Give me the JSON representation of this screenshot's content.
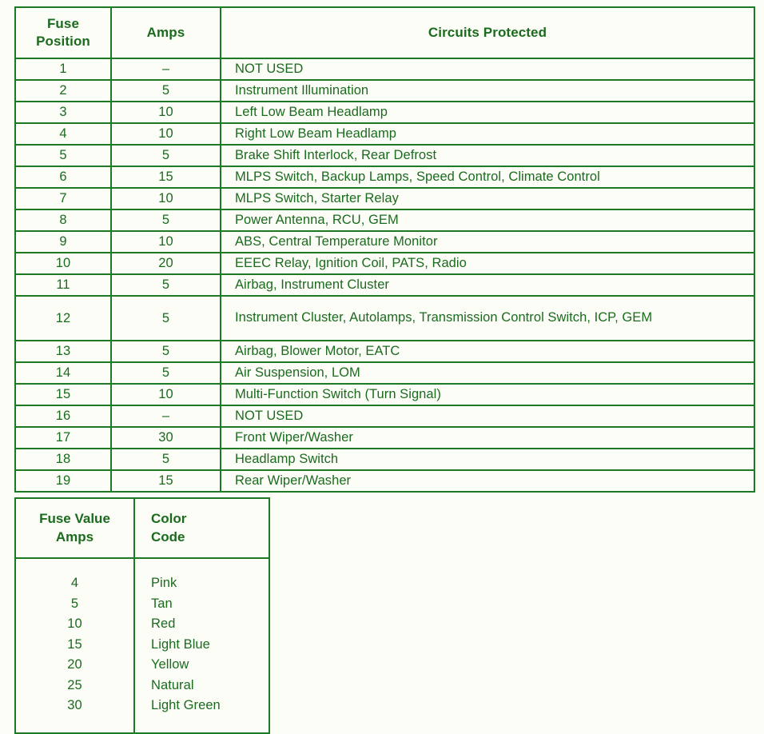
{
  "fuse_table": {
    "headers": {
      "position": "Fuse\nPosition",
      "position_line1": "Fuse",
      "position_line2": "Position",
      "amps": "Amps",
      "circuits": "Circuits Protected"
    },
    "rows": [
      {
        "position": "1",
        "amps": "–",
        "circuits": "NOT USED"
      },
      {
        "position": "2",
        "amps": "5",
        "circuits": "Instrument Illumination"
      },
      {
        "position": "3",
        "amps": "10",
        "circuits": "Left Low Beam Headlamp"
      },
      {
        "position": "4",
        "amps": "10",
        "circuits": "Right Low Beam Headlamp"
      },
      {
        "position": "5",
        "amps": "5",
        "circuits": "Brake Shift Interlock, Rear Defrost"
      },
      {
        "position": "6",
        "amps": "15",
        "circuits": "MLPS Switch, Backup Lamps, Speed Control, Climate Control"
      },
      {
        "position": "7",
        "amps": "10",
        "circuits": "MLPS Switch, Starter Relay"
      },
      {
        "position": "8",
        "amps": "5",
        "circuits": "Power Antenna, RCU, GEM"
      },
      {
        "position": "9",
        "amps": "10",
        "circuits": "ABS, Central Temperature Monitor"
      },
      {
        "position": "10",
        "amps": "20",
        "circuits": "EEEC Relay, Ignition Coil, PATS, Radio"
      },
      {
        "position": "11",
        "amps": "5",
        "circuits": "Airbag, Instrument Cluster"
      },
      {
        "position": "12",
        "amps": "5",
        "circuits": "Instrument Cluster, Autolamps, Transmission Control Switch, ICP, GEM",
        "tall": true
      },
      {
        "position": "13",
        "amps": "5",
        "circuits": "Airbag, Blower Motor, EATC"
      },
      {
        "position": "14",
        "amps": "5",
        "circuits": "Air Suspension, LOM"
      },
      {
        "position": "15",
        "amps": "10",
        "circuits": "Multi-Function Switch (Turn Signal)"
      },
      {
        "position": "16",
        "amps": "–",
        "circuits": "NOT USED"
      },
      {
        "position": "17",
        "amps": "30",
        "circuits": "Front Wiper/Washer"
      },
      {
        "position": "18",
        "amps": "5",
        "circuits": "Headlamp Switch"
      },
      {
        "position": "19",
        "amps": "15",
        "circuits": "Rear Wiper/Washer"
      }
    ]
  },
  "color_table": {
    "headers": {
      "value_line1": "Fuse Value",
      "value_line2": "Amps",
      "color_line1": "Color",
      "color_line2": "Code"
    },
    "rows": [
      {
        "amps": "4",
        "color": "Pink"
      },
      {
        "amps": "5",
        "color": "Tan"
      },
      {
        "amps": "10",
        "color": "Red"
      },
      {
        "amps": "15",
        "color": "Light Blue"
      },
      {
        "amps": "20",
        "color": "Yellow"
      },
      {
        "amps": "25",
        "color": "Natural"
      },
      {
        "amps": "30",
        "color": "Light Green"
      }
    ]
  },
  "colors": {
    "text_green": "#1a6b1e",
    "border_green": "#1e7a22",
    "page_background": "#fdfdf8"
  }
}
